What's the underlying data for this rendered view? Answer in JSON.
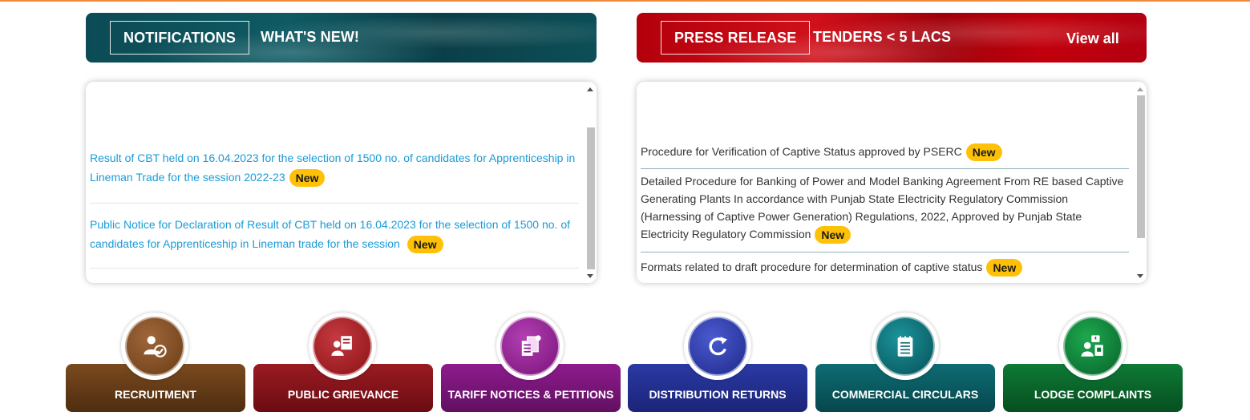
{
  "left_tabs": {
    "notifications": "NOTIFICATIONS",
    "whats_new": "WHAT'S NEW!"
  },
  "right_tabs": {
    "press_release": "PRESS RELEASE",
    "tenders": "TENDERS < 5 LACS",
    "view_all": "View all"
  },
  "notifications": [
    {
      "text": "Result of CBT held on 16.04.2023 for the selection of 1500 no. of candidates for Apprenticeship in Lineman Trade for the session 2022-23",
      "badge": "New"
    },
    {
      "text": "Public Notice for Declaration of Result of CBT held on 16.04.2023 for the selection of 1500 no. of candidates for Apprenticeship in Lineman trade for the session",
      "badge": "New"
    }
  ],
  "press_releases": [
    {
      "text": "Procedure for Verification of Captive Status approved by PSERC",
      "badge": "New"
    },
    {
      "text": "Detailed Procedure for Banking of Power and Model Banking Agreement From RE based Captive Generating Plants In accordance with Punjab State Electricity Regulatory Commission (Harnessing of Captive Power Generation) Regulations, 2022, Approved by Punjab State Electricity Regulatory Commission",
      "badge": "New"
    },
    {
      "text": "Formats related to draft procedure for determination of captive status",
      "badge": "New"
    }
  ],
  "quick_links": [
    {
      "label": "RECRUITMENT",
      "icon": "recruitment-icon",
      "color": "#7a4a1e"
    },
    {
      "label": "PUBLIC GRIEVANCE",
      "icon": "grievance-icon",
      "color": "#9b1b22"
    },
    {
      "label": "TARIFF NOTICES & PETITIONS",
      "icon": "tariff-notices-icon",
      "color": "#8e1b8e"
    },
    {
      "label": "DISTRIBUTION RETURNS",
      "icon": "refresh-icon",
      "color": "#2a3aa4"
    },
    {
      "label": "COMMERCIAL CIRCULARS",
      "icon": "notepad-icon",
      "color": "#0e6c73"
    },
    {
      "label": "LODGE COMPLAINTS",
      "icon": "complaint-icon",
      "color": "#0e7a35"
    }
  ],
  "colors": {
    "accent_orange": "#f08a3a",
    "link_blue": "#1a9bd7",
    "badge_yellow": "#ffc107"
  }
}
